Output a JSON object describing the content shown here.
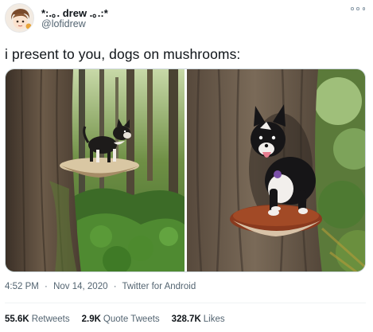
{
  "author": {
    "display_name": "*:.｡. drew .｡.:*",
    "handle": "@lofidrew"
  },
  "tweet": {
    "text": "i present to you, dogs on mushrooms:"
  },
  "media": {
    "photos": [
      {
        "subject": "small black and white chihuahua standing on a shelf mushroom on a tree trunk in a forest"
      },
      {
        "subject": "small black and white dog with tongue out standing on a brown shelf mushroom on a tree trunk"
      }
    ]
  },
  "meta": {
    "time": "4:52 PM",
    "separator": "·",
    "date": "Nov 14, 2020",
    "source": "Twitter for Android"
  },
  "stats": {
    "retweets_count": "55.6K",
    "retweets_label": "Retweets",
    "quotes_count": "2.9K",
    "quotes_label": "Quote Tweets",
    "likes_count": "328.7K",
    "likes_label": "Likes"
  },
  "colors": {
    "text_primary": "#0f1419",
    "text_secondary": "#536471",
    "border": "#cfd9de"
  },
  "icons": {
    "more": "more-options-icon"
  }
}
